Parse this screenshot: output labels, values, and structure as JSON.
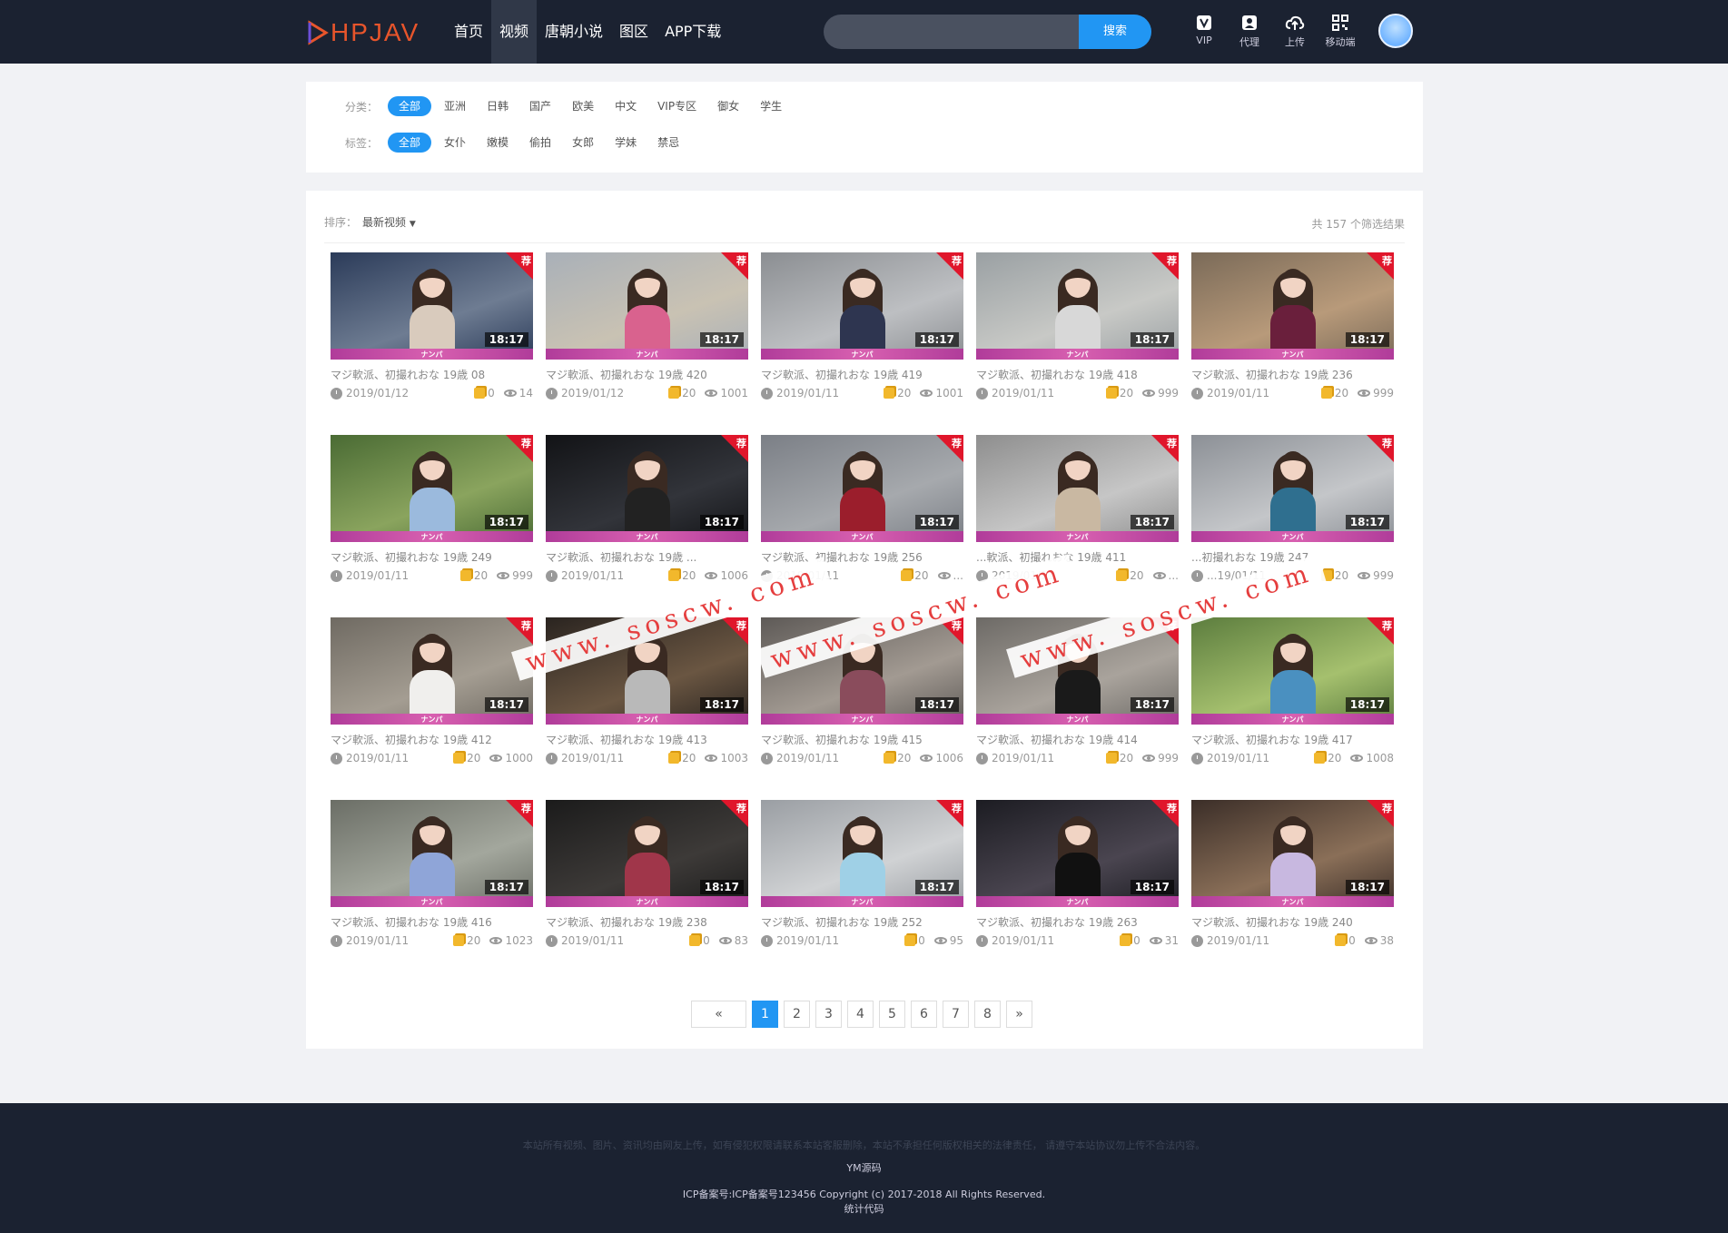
{
  "header": {
    "logo_text": "HPJAV",
    "nav": [
      {
        "label": "首页",
        "active": false
      },
      {
        "label": "视频",
        "active": true
      },
      {
        "label": "唐朝小说",
        "active": false
      },
      {
        "label": "图区",
        "active": false
      },
      {
        "label": "APP下载",
        "active": false
      }
    ],
    "search_button": "搜索",
    "tools": [
      {
        "label": "VIP",
        "icon": "vip-icon"
      },
      {
        "label": "代理",
        "icon": "agent-icon"
      },
      {
        "label": "上传",
        "icon": "upload-cloud-icon"
      },
      {
        "label": "移动端",
        "icon": "qrcode-icon"
      }
    ]
  },
  "filter": {
    "category_label": "分类：",
    "categories": [
      "全部",
      "亚洲",
      "日韩",
      "国产",
      "欧美",
      "中文",
      "VIP专区",
      "御女",
      "学生"
    ],
    "tag_label": "标签：",
    "tags": [
      "全部",
      "女仆",
      "嫩模",
      "偷拍",
      "女郎",
      "学妹",
      "禁忌"
    ]
  },
  "sortbar": {
    "label": "排序：",
    "selected": "最新视频",
    "arrow": "▼",
    "result_count": "共 157 个筛选结果"
  },
  "videos": [
    {
      "title": "マジ軟派、初撮れおな 19歳 08",
      "date": "2019/01/12",
      "coins": "0",
      "views": "14",
      "duration": "18:17",
      "palette": [
        "#2b3b59",
        "#6e7c92",
        "#d9cbbd"
      ]
    },
    {
      "title": "マジ軟派、初撮れおな 19歳 420",
      "date": "2019/01/12",
      "coins": "20",
      "views": "1001",
      "duration": "18:17",
      "palette": [
        "#a9b0b8",
        "#c9c2b3",
        "#d9628e"
      ]
    },
    {
      "title": "マジ軟派、初撮れおな 19歳 419",
      "date": "2019/01/11",
      "coins": "20",
      "views": "1001",
      "duration": "18:17",
      "palette": [
        "#8b8e92",
        "#bdbfc2",
        "#2e3550"
      ]
    },
    {
      "title": "マジ軟派、初撮れおな 19歳 418",
      "date": "2019/01/11",
      "coins": "20",
      "views": "999",
      "duration": "18:17",
      "palette": [
        "#9aa0a3",
        "#c8c9c6",
        "#d8d8d8"
      ]
    },
    {
      "title": "マジ軟派、初撮れおな 19歳 236",
      "date": "2019/01/11",
      "coins": "20",
      "views": "999",
      "duration": "18:17",
      "palette": [
        "#7a6a58",
        "#b89a7a",
        "#6a1f3c"
      ]
    },
    {
      "title": "マジ軟派、初撮れおな 19歳 249",
      "date": "2019/01/11",
      "coins": "20",
      "views": "999",
      "duration": "18:17",
      "palette": [
        "#4a6b34",
        "#8aa45e",
        "#9bbadd"
      ]
    },
    {
      "title": "マジ軟派、初撮れおな 19歳 ...",
      "date": "2019/01/11",
      "coins": "20",
      "views": "1006",
      "duration": "18:17",
      "palette": [
        "#121316",
        "#32343a",
        "#222222"
      ]
    },
    {
      "title": "マジ軟派、初撮れおな 19歳 256",
      "date": "2019/01/11",
      "coins": "20",
      "views": "...",
      "duration": "18:17",
      "palette": [
        "#7b7f86",
        "#a6a9ad",
        "#9b1e2c"
      ]
    },
    {
      "title": "...軟派、初撮れおな 19歳 411",
      "date": "2019/01/11",
      "coins": "20",
      "views": "...",
      "duration": "18:17",
      "palette": [
        "#8e8e8e",
        "#c6c6c6",
        "#c9b8a2"
      ]
    },
    {
      "title": "...初撮れおな 19歳 247",
      "date": "...19/01/11",
      "coins": "20",
      "views": "999",
      "duration": "18:17",
      "palette": [
        "#8c9096",
        "#c4c6c9",
        "#2f6f8f"
      ]
    },
    {
      "title": "マジ軟派、初撮れおな 19歳 412",
      "date": "2019/01/11",
      "coins": "20",
      "views": "1000",
      "duration": "18:17",
      "palette": [
        "#6f6a62",
        "#a49d92",
        "#f0efed"
      ]
    },
    {
      "title": "マジ軟派、初撮れおな 19歳 413",
      "date": "2019/01/11",
      "coins": "20",
      "views": "1003",
      "duration": "18:17",
      "palette": [
        "#2a2420",
        "#6a5642",
        "#b9b9b9"
      ]
    },
    {
      "title": "マジ軟派、初撮れおな 19歳 415",
      "date": "2019/01/11",
      "coins": "20",
      "views": "1006",
      "duration": "18:17",
      "palette": [
        "#5e5a57",
        "#a29a92",
        "#8a4c5c"
      ]
    },
    {
      "title": "マジ軟派、初撮れおな 19歳 414",
      "date": "2019/01/11",
      "coins": "20",
      "views": "999",
      "duration": "18:17",
      "palette": [
        "#6d6a66",
        "#a9a39c",
        "#1a1a1a"
      ]
    },
    {
      "title": "マジ軟派、初撮れおな 19歳 417",
      "date": "2019/01/11",
      "coins": "20",
      "views": "1008",
      "duration": "18:17",
      "palette": [
        "#5c7d3e",
        "#a5c06e",
        "#4a90c0"
      ]
    },
    {
      "title": "マジ軟派、初撮れおな 19歳 416",
      "date": "2019/01/11",
      "coins": "20",
      "views": "1023",
      "duration": "18:17",
      "palette": [
        "#6b6e66",
        "#a3a79d",
        "#8fa5d8"
      ]
    },
    {
      "title": "マジ軟派、初撮れおな 19歳 238",
      "date": "2019/01/11",
      "coins": "0",
      "views": "83",
      "duration": "18:17",
      "palette": [
        "#1b1b1b",
        "#3d3a38",
        "#a0364a"
      ]
    },
    {
      "title": "マジ軟派、初撮れおな 19歳 252",
      "date": "2019/01/11",
      "coins": "0",
      "views": "95",
      "duration": "18:17",
      "palette": [
        "#9a9ea3",
        "#d0d2d4",
        "#9fd0e6"
      ]
    },
    {
      "title": "マジ軟派、初撮れおな 19歳 263",
      "date": "2019/01/11",
      "coins": "0",
      "views": "31",
      "duration": "18:17",
      "palette": [
        "#1c1c22",
        "#4a4550",
        "#111111"
      ]
    },
    {
      "title": "マジ軟派、初撮れおな 19歳 240",
      "date": "2019/01/11",
      "coins": "0",
      "views": "38",
      "duration": "18:17",
      "palette": [
        "#3b2e28",
        "#8a6f58",
        "#c8b8e0"
      ]
    }
  ],
  "thumb_badge": "荐",
  "thumb_band_text": "ナンパ",
  "pagination": {
    "prev": "«",
    "pages": [
      "1",
      "2",
      "3",
      "4",
      "5",
      "6",
      "7",
      "8"
    ],
    "current": "1",
    "next": "»"
  },
  "watermark": "www. soscw. com",
  "footer": {
    "disclaimer": "本站所有视频、图片、资讯均由网友上传，如有侵犯权限请联系本站客服删除，本站不承担任何版权相关的法律责任， 请遵守本站协议勿上传不合法内容。",
    "source": "YM源码",
    "copyright": "ICP备案号:ICP备案号123456    Copyright (c) 2017-2018 All Rights Reserved.",
    "stats": "统计代码"
  }
}
